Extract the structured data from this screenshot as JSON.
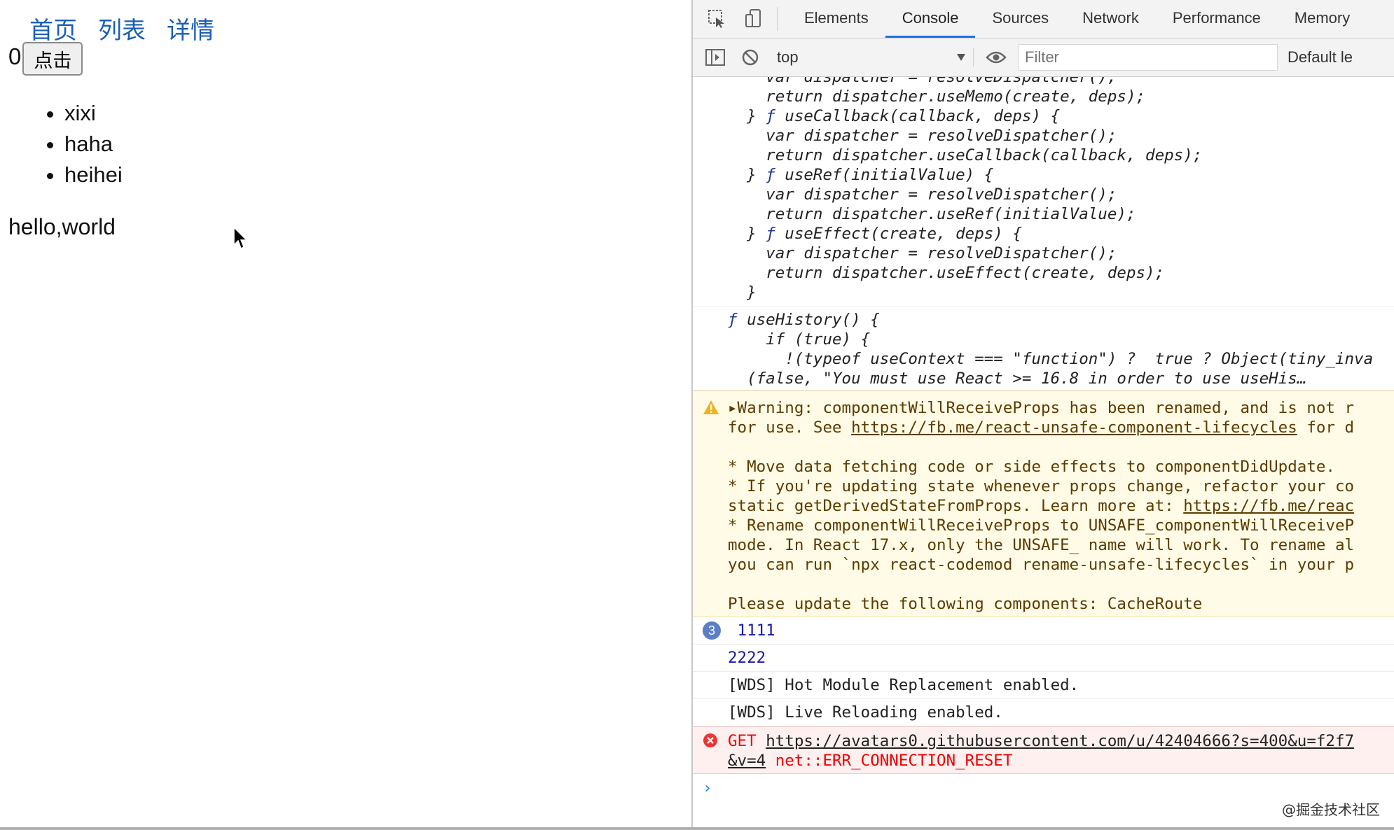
{
  "app": {
    "nav": [
      "首页",
      "列表",
      "详情"
    ],
    "counter_value": "0",
    "button_label": "点击",
    "list": [
      "xixi",
      "haha",
      "heihei"
    ],
    "message": "hello,world"
  },
  "devtools": {
    "tabs": [
      "Elements",
      "Console",
      "Sources",
      "Network",
      "Performance",
      "Memory"
    ],
    "active_tab": "Console",
    "context": "top",
    "filter_placeholder": "Filter",
    "levels_label": "Default le",
    "code_block_1": [
      "    var dispatcher = resolveDispatcher();",
      "    return dispatcher.useMemo(create, deps);",
      "  } ",
      "    var dispatcher = resolveDispatcher();",
      "    return dispatcher.useCallback(callback, deps);",
      "  } ",
      "    var dispatcher = resolveDispatcher();",
      "    return dispatcher.useRef(initialValue);",
      "  } ",
      "    var dispatcher = resolveDispatcher();",
      "    return dispatcher.useEffect(create, deps);",
      "  }"
    ],
    "fn_use_callback": "useCallback(callback, deps) {",
    "fn_use_ref": "useRef(initialValue) {",
    "fn_use_effect": "useEffect(create, deps) {",
    "fn_use_history": "useHistory() {",
    "code_block_2": [
      "    if (true) {",
      "      !(typeof useContext === \"function\") ?  true ? Object(tiny_inva",
      "  (false, \"You must use React >= 16.8 in order to use useHis…"
    ],
    "warning": {
      "line1": "Warning: componentWillReceiveProps has been renamed, and is not r",
      "line2_pre": "for use. See ",
      "line2_link": "https://fb.me/react-unsafe-component-lifecycles",
      "line2_post": " for d",
      "line4": "* Move data fetching code or side effects to componentDidUpdate.",
      "line5": "* If you're updating state whenever props change, refactor your co",
      "line6_pre": "static getDerivedStateFromProps. Learn more at: ",
      "line6_link": "https://fb.me/reac",
      "line7": "* Rename componentWillReceiveProps to UNSAFE_componentWillReceiveP",
      "line8": "mode. In React 17.x, only the UNSAFE_ name will work. To rename al",
      "line9": "you can run `npx react-codemod rename-unsafe-lifecycles` in your p",
      "line11": "Please update the following components: CacheRoute"
    },
    "log_1111": {
      "count": "3",
      "text": "1111"
    },
    "log_2222": "2222",
    "log_wds_hmr": "[WDS] Hot Module Replacement enabled.",
    "log_wds_live": "[WDS] Live Reloading enabled.",
    "error": {
      "method": "GET ",
      "url_line1": "https://avatars0.githubusercontent.com/u/42404666?s=400&u=f2f7",
      "url_line2": "&v=4",
      "message": " net::ERR_CONNECTION_RESET"
    },
    "prompt": "›"
  },
  "watermark": "@掘金技术社区",
  "colors": {
    "link": "#1a5fb4",
    "tab_active": "#1a73e8",
    "warning_bg": "#fffbe6",
    "error_text": "#e00000"
  }
}
